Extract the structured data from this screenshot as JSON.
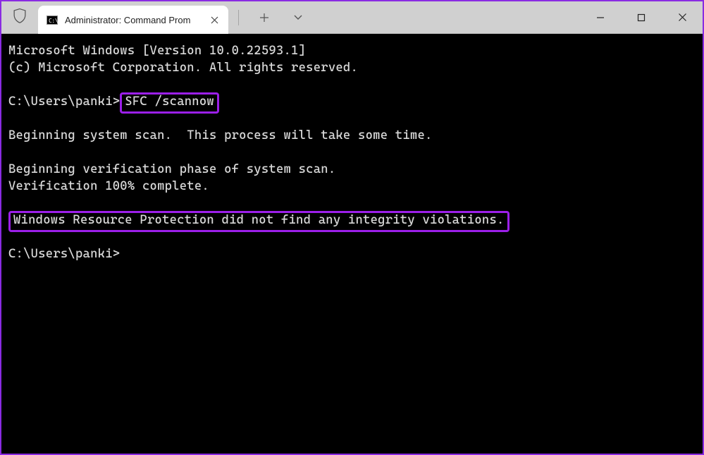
{
  "window": {
    "tab_title": "Administrator: Command Prom"
  },
  "terminal": {
    "line1": "Microsoft Windows [Version 10.0.22593.1]",
    "line2": "(c) Microsoft Corporation. All rights reserved.",
    "prompt1_prefix": "C:\\Users\\panki>",
    "prompt1_cmd": "SFC /scannow",
    "line_scan": "Beginning system scan.  This process will take some time.",
    "line_verif1": "Beginning verification phase of system scan.",
    "line_verif2": "Verification 100% complete.",
    "result": "Windows Resource Protection did not find any integrity violations.",
    "prompt2": "C:\\Users\\panki>"
  }
}
